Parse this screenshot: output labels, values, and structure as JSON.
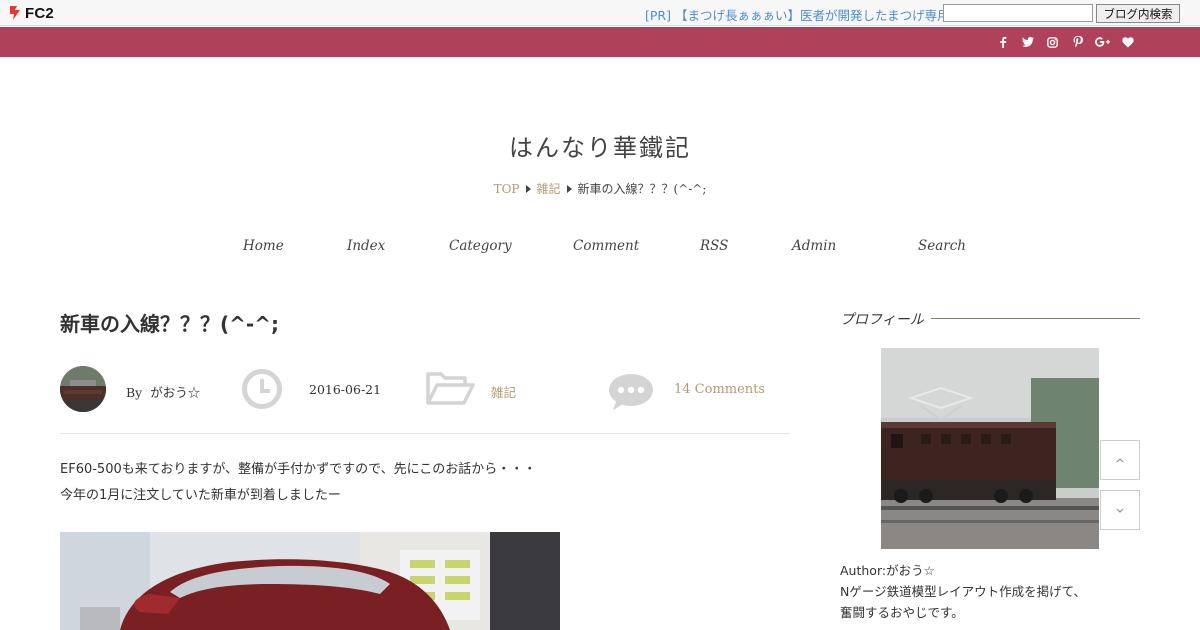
{
  "fc2bar": {
    "logo_text": "FC2",
    "pr_link": "[PR] 【まつげ長ぁぁぁい】医者が開発したまつげ専用",
    "search_placeholder": "",
    "search_button": "ブログ内検索"
  },
  "social": {
    "icons": [
      "facebook-icon",
      "twitter-icon",
      "instagram-icon",
      "pinterest-icon",
      "google-plus-icon",
      "heart-icon"
    ],
    "bar_color": "#b0415a"
  },
  "site": {
    "title": "はんなり華鐵記"
  },
  "breadcrumb": {
    "top": "TOP",
    "category": "雑記",
    "current": "新車の入線？？？(^-^;"
  },
  "nav": {
    "home": "Home",
    "index": "Index",
    "category": "Category",
    "comment": "Comment",
    "rss": "RSS",
    "admin": "Admin",
    "search": "Search"
  },
  "post": {
    "title": "新車の入線？？？(^-^;",
    "author_prefix": "By",
    "author": "がおう☆",
    "date": "2016-06-21",
    "category": "雑記",
    "comments": "14 Comments",
    "body": [
      "EF60-500も来ておりますが、整備が手付かずですので、先にこのお話から・・・",
      "今年の1月に注文していた新車が到着しましたー"
    ]
  },
  "sidebar": {
    "profile_heading": "プロフィール",
    "profile_lines": [
      "Author:がおう☆",
      "Nゲージ鉄道模型レイアウト作成を掲げて、",
      "奮闘するおやじです。"
    ]
  },
  "colors": {
    "accent": "#b39a6e",
    "link": "#4d8ed0"
  }
}
